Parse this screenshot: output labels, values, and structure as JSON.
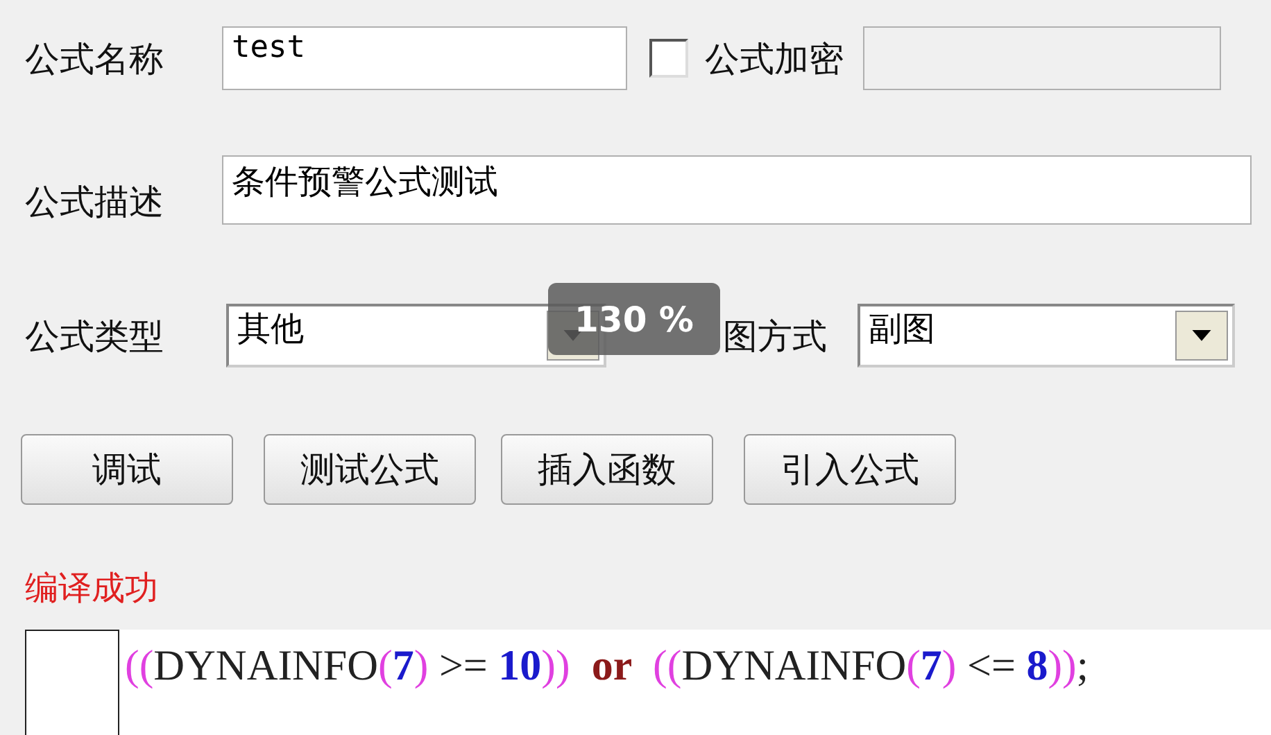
{
  "name_row": {
    "label": "公式名称",
    "value": "test",
    "encrypt": {
      "label": "公式加密",
      "checked": false
    }
  },
  "desc_row": {
    "label": "公式描述",
    "value": "条件预警公式测试"
  },
  "type_row": {
    "label": "公式类型",
    "value": "其他",
    "draw_label": "图方式",
    "draw_value": "副图"
  },
  "zoom_badge": "130 %",
  "buttons": [
    "调试",
    "测试公式",
    "插入函数",
    "引入公式"
  ],
  "status": "编译成功",
  "code": [
    {
      "kind": "paren",
      "text": "(("
    },
    {
      "kind": "func",
      "text": "DYNAINFO"
    },
    {
      "kind": "paren",
      "text": "("
    },
    {
      "kind": "num",
      "text": "7"
    },
    {
      "kind": "paren",
      "text": ")"
    },
    {
      "kind": "op",
      "text": " >= "
    },
    {
      "kind": "num",
      "text": "10"
    },
    {
      "kind": "paren",
      "text": "))"
    },
    {
      "kind": "kw",
      "text": "  or  "
    },
    {
      "kind": "paren",
      "text": "(("
    },
    {
      "kind": "func",
      "text": "DYNAINFO"
    },
    {
      "kind": "paren",
      "text": "("
    },
    {
      "kind": "num",
      "text": "7"
    },
    {
      "kind": "paren",
      "text": ")"
    },
    {
      "kind": "op",
      "text": " <= "
    },
    {
      "kind": "num",
      "text": "8"
    },
    {
      "kind": "paren",
      "text": "))"
    },
    {
      "kind": "func",
      "text": ";"
    }
  ]
}
